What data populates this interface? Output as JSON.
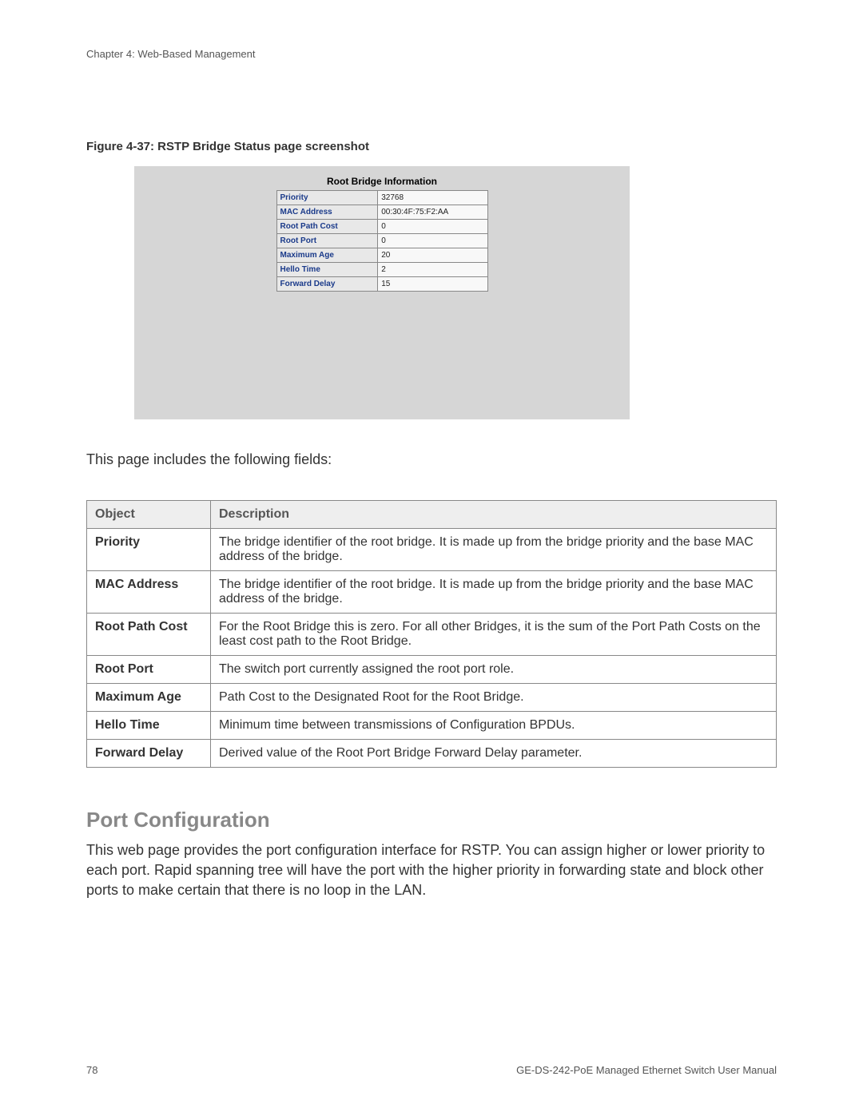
{
  "header": {
    "chapter": "Chapter 4: Web-Based Management"
  },
  "figure": {
    "caption": "Figure 4-37: RSTP Bridge Status page screenshot",
    "screenshot": {
      "title": "Root Bridge Information",
      "rows": [
        {
          "label": "Priority",
          "value": "32768"
        },
        {
          "label": "MAC Address",
          "value": "00:30:4F:75:F2:AA"
        },
        {
          "label": "Root Path Cost",
          "value": "0"
        },
        {
          "label": "Root Port",
          "value": "0"
        },
        {
          "label": "Maximum Age",
          "value": "20"
        },
        {
          "label": "Hello Time",
          "value": "2"
        },
        {
          "label": "Forward Delay",
          "value": "15"
        }
      ]
    }
  },
  "intro": "This page includes the following fields:",
  "fields_table": {
    "headers": {
      "object": "Object",
      "description": "Description"
    },
    "rows": [
      {
        "object": "Priority",
        "description": "The bridge identifier of the root bridge. It is made up from the bridge priority and the base MAC address of the bridge."
      },
      {
        "object": "MAC Address",
        "description": "The bridge identifier of the root bridge. It is made up from the bridge priority and the base MAC address of the bridge."
      },
      {
        "object": "Root Path Cost",
        "description": "For the Root Bridge this is zero. For all other Bridges, it is the sum of the Port Path Costs on the least cost path to the Root Bridge."
      },
      {
        "object": "Root Port",
        "description": "The switch port currently assigned the root port role."
      },
      {
        "object": "Maximum Age",
        "description": "Path Cost to the Designated Root for the Root Bridge."
      },
      {
        "object": "Hello Time",
        "description": "Minimum time between transmissions of Configuration BPDUs."
      },
      {
        "object": "Forward Delay",
        "description": "Derived value of the Root Port Bridge Forward Delay parameter."
      }
    ]
  },
  "section": {
    "heading": "Port Configuration",
    "body": "This web page provides the port configuration interface for RSTP. You can assign higher or lower priority to each port. Rapid spanning tree will have the port with the higher priority in forwarding state and block other ports to make certain that there is no loop in the LAN."
  },
  "footer": {
    "page_number": "78",
    "manual_title": "GE-DS-242-PoE Managed Ethernet Switch User Manual"
  }
}
